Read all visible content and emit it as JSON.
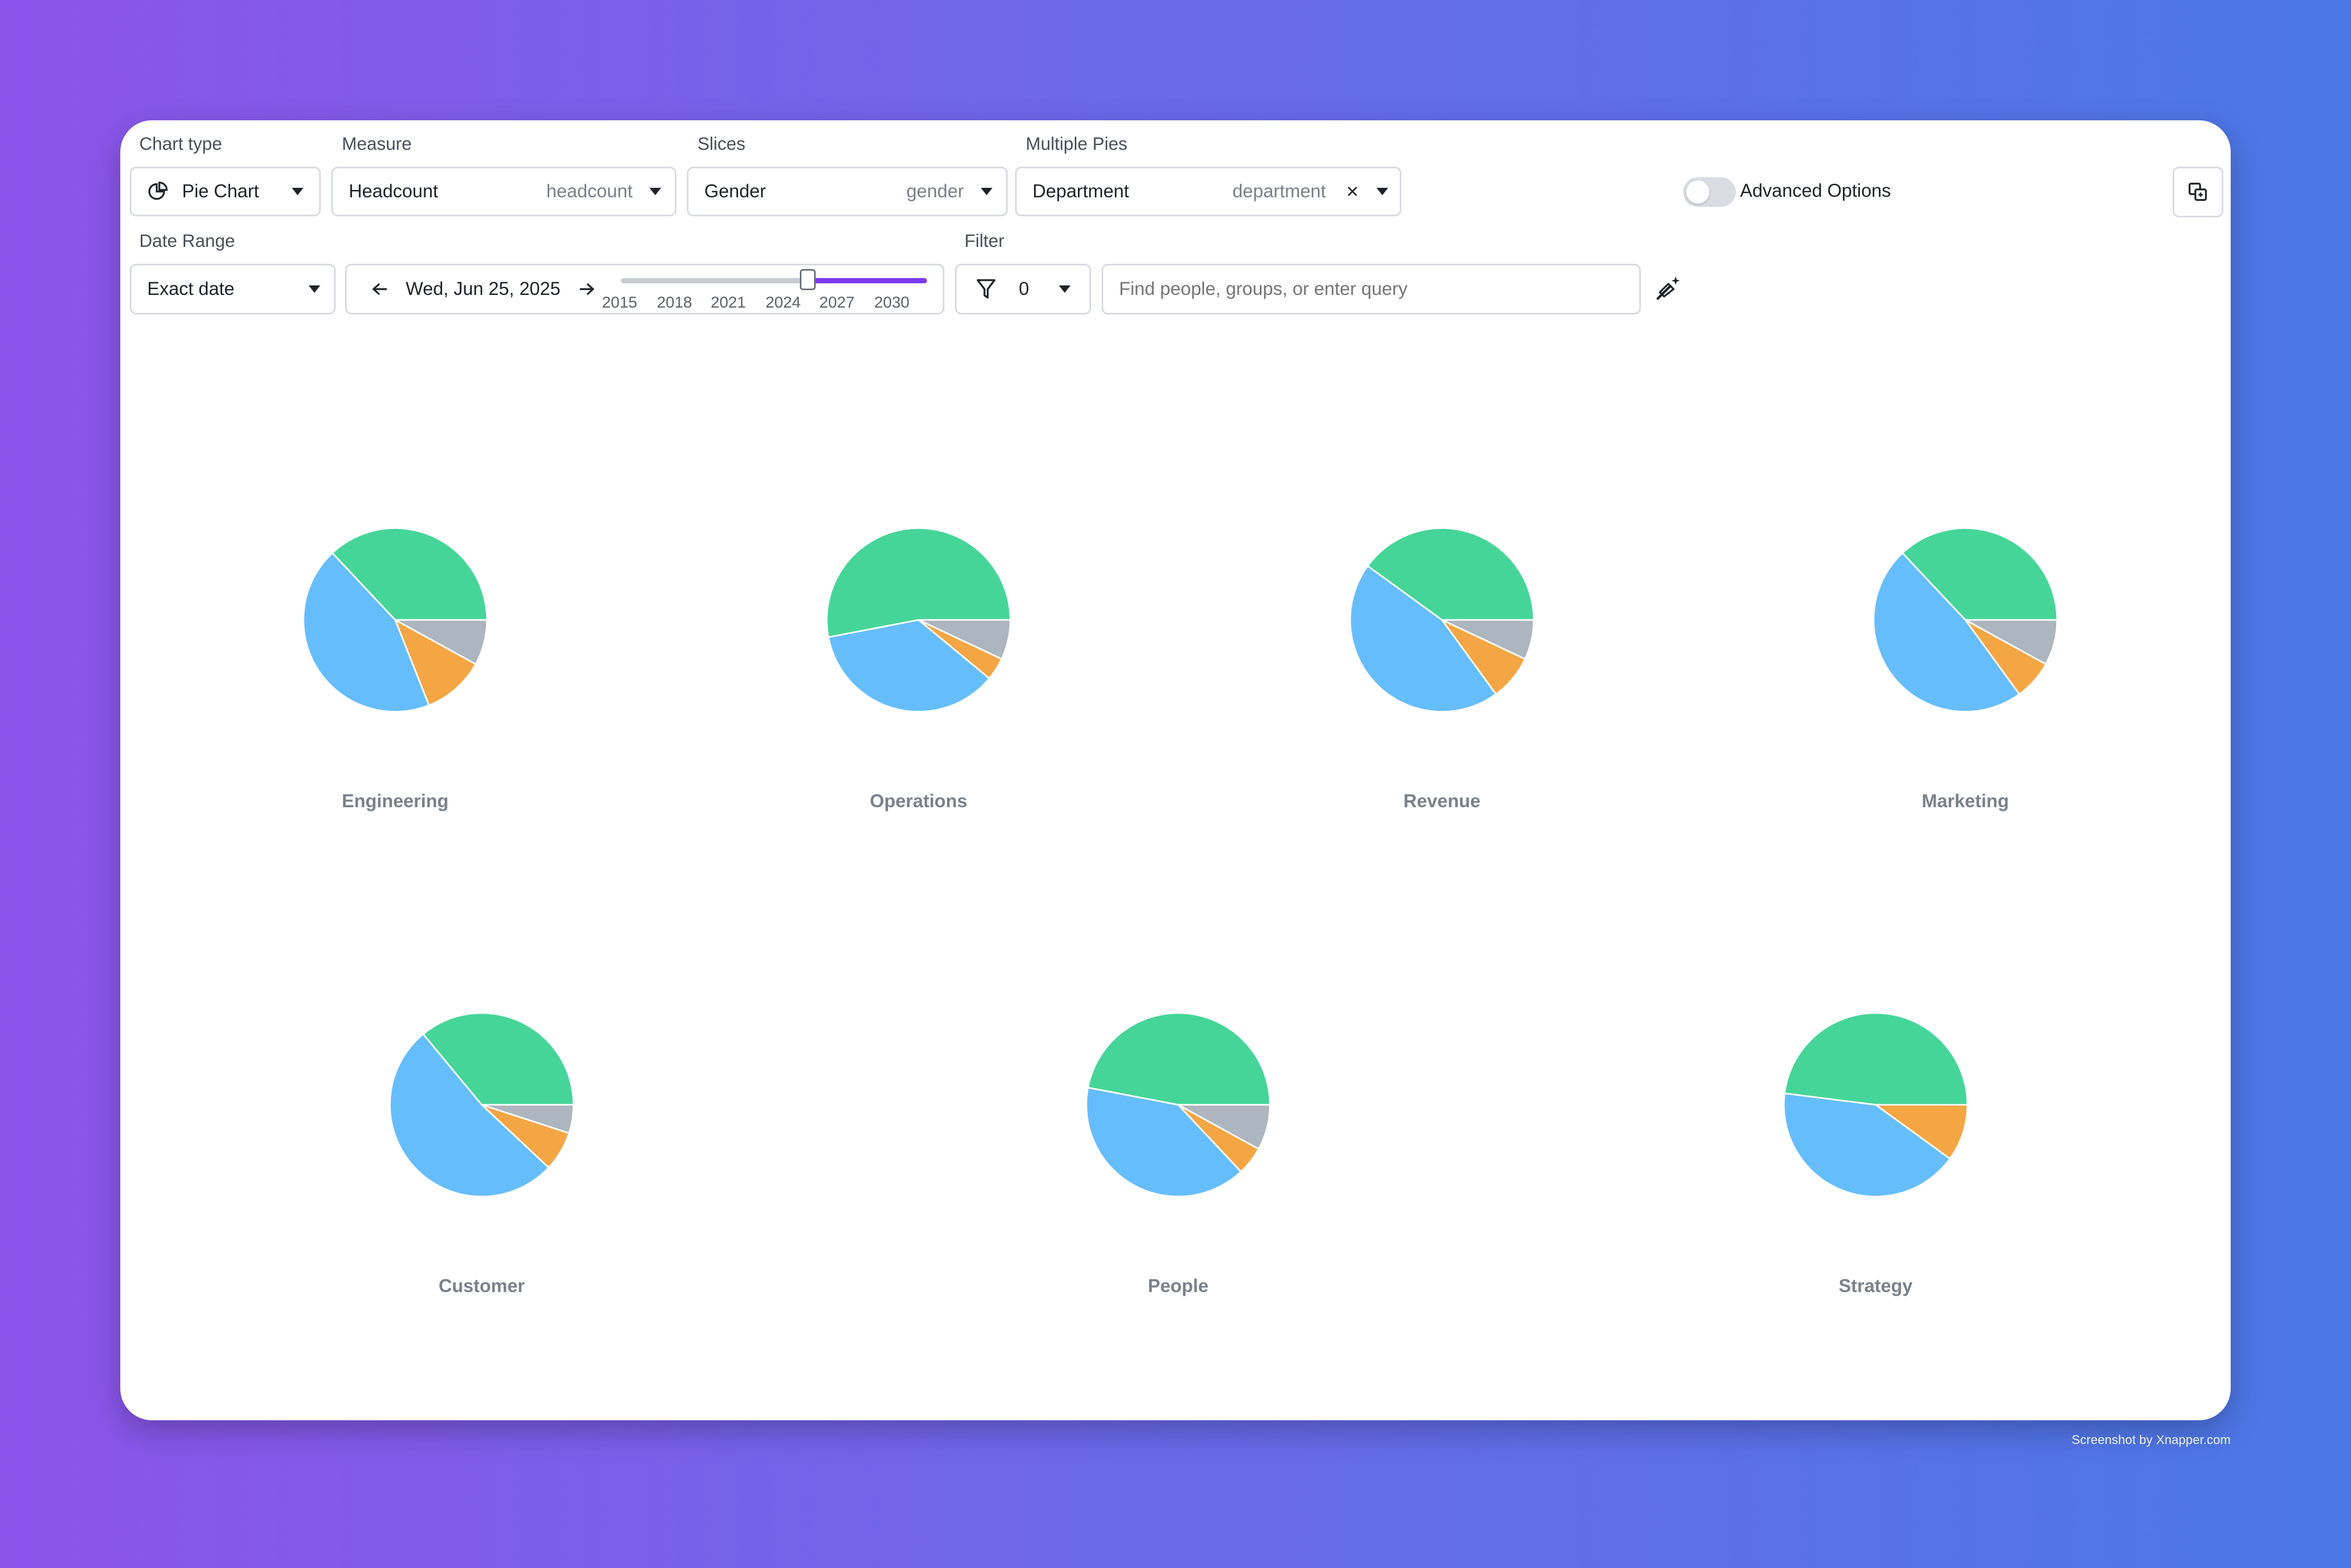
{
  "controls": {
    "chart_type": {
      "label": "Chart type",
      "value": "Pie Chart"
    },
    "measure": {
      "label": "Measure",
      "value": "Headcount",
      "hint": "headcount"
    },
    "slices": {
      "label": "Slices",
      "value": "Gender",
      "hint": "gender"
    },
    "multiple_pies": {
      "label": "Multiple Pies",
      "value": "Department",
      "hint": "department",
      "clear": "×"
    },
    "advanced_options": {
      "label": "Advanced Options",
      "enabled": false
    },
    "date_range": {
      "label": "Date Range",
      "value": "Exact date"
    },
    "date": {
      "value": "Wed, Jun 25, 2025",
      "slider_years": [
        "2015",
        "2018",
        "2021",
        "2024",
        "2027",
        "2030"
      ],
      "slider_position": 0.61
    },
    "filter": {
      "label": "Filter",
      "count": "0"
    },
    "search": {
      "placeholder": "Find people, groups, or enter query"
    }
  },
  "colors": {
    "green": "#46d598",
    "blue": "#66bdfc",
    "orange": "#f5a644",
    "gray": "#adb6be",
    "accent": "#7c3aed"
  },
  "chart_data": {
    "type": "pie",
    "slice_order": [
      "gray",
      "orange",
      "blue",
      "green"
    ],
    "pies": [
      {
        "category": "Engineering",
        "values": [
          8,
          11,
          44,
          37
        ]
      },
      {
        "category": "Operations",
        "values": [
          7,
          4,
          36,
          53
        ]
      },
      {
        "category": "Revenue",
        "values": [
          7,
          8,
          45,
          40
        ]
      },
      {
        "category": "Marketing",
        "values": [
          8,
          7,
          48,
          37
        ]
      },
      {
        "category": "Customer",
        "values": [
          5,
          7,
          52,
          36
        ]
      },
      {
        "category": "People",
        "values": [
          8,
          5,
          40,
          47
        ]
      },
      {
        "category": "Strategy",
        "values": [
          0,
          10,
          42,
          48
        ]
      }
    ]
  },
  "footer": "Screenshot by Xnapper.com"
}
